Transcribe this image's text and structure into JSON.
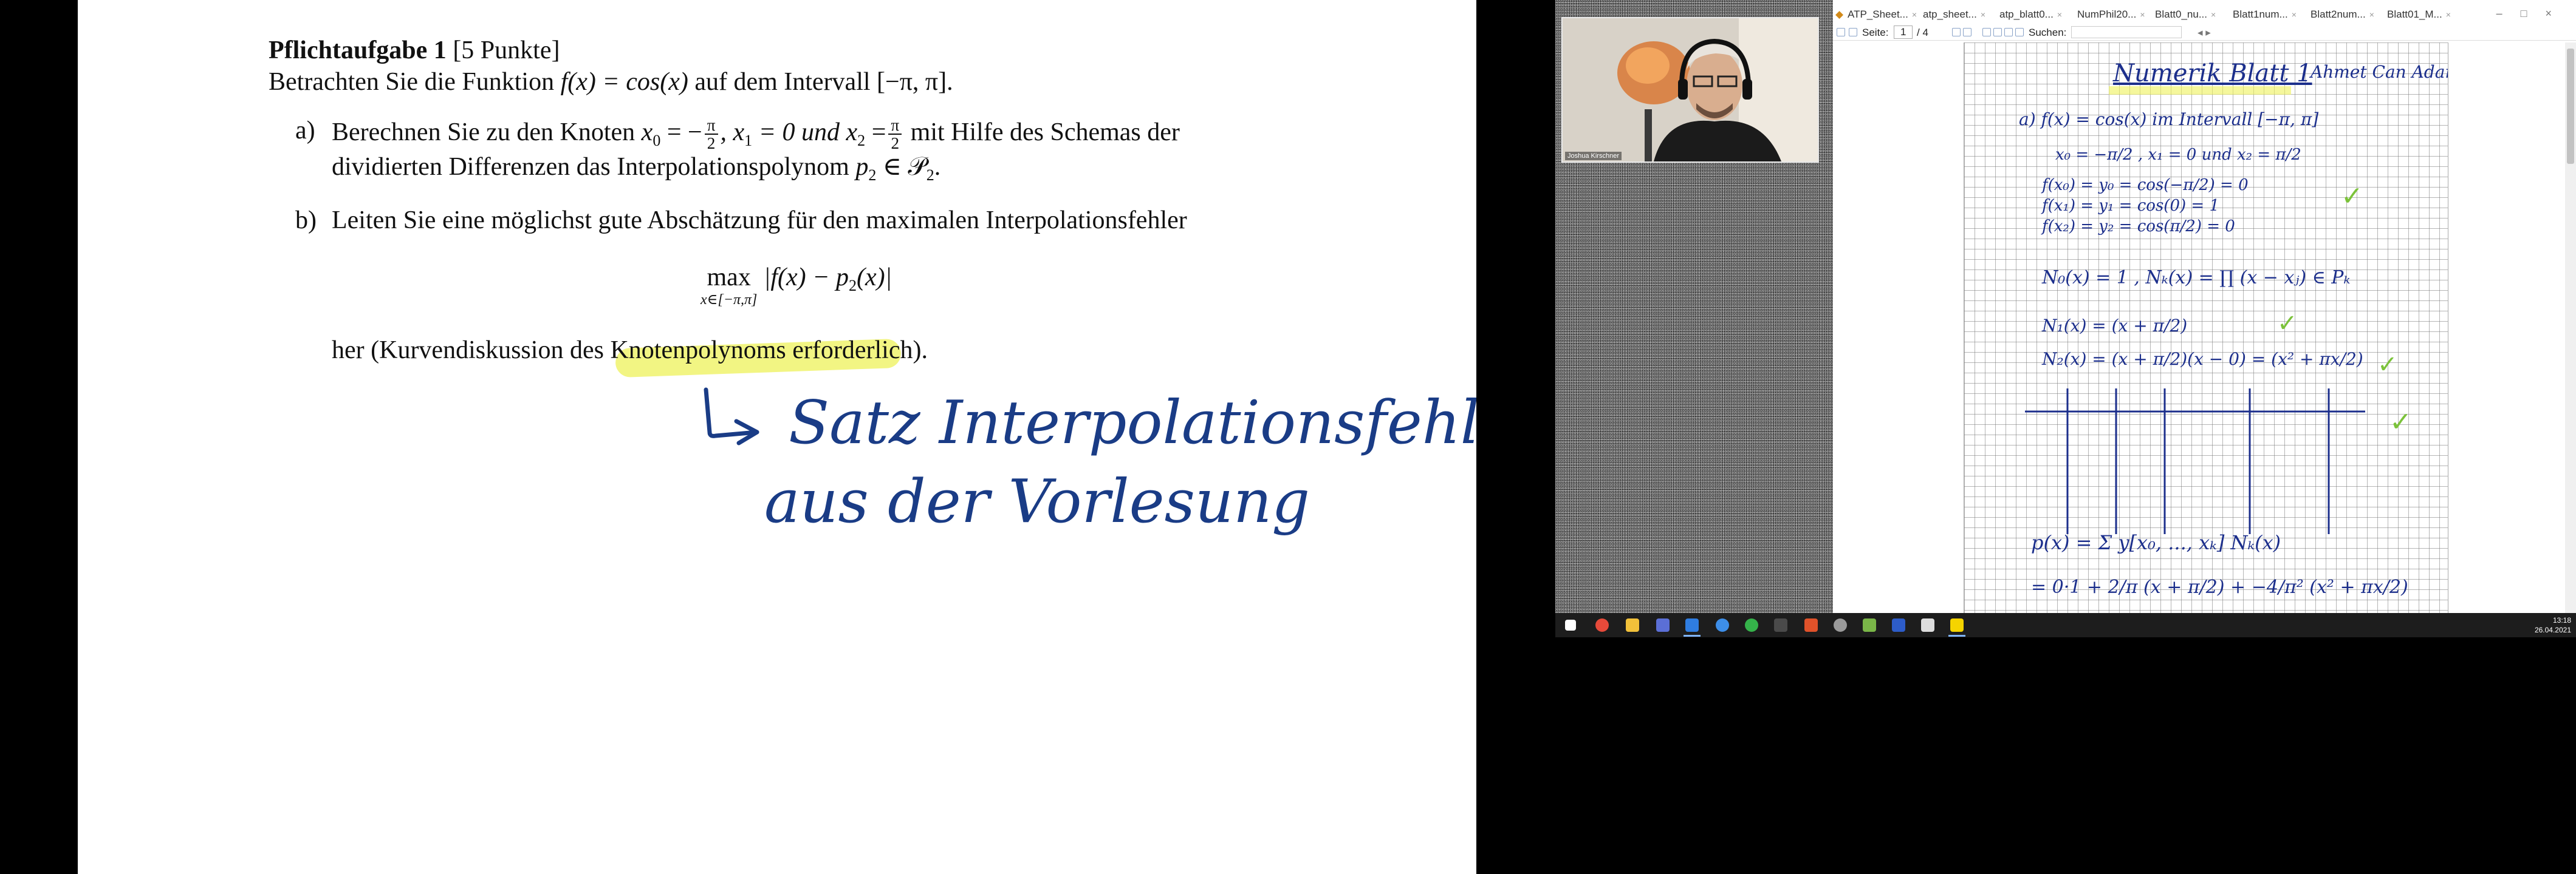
{
  "document": {
    "heading_bold": "Pflichtaufgabe 1",
    "heading_points": "[5 Punkte]",
    "intro": {
      "prefix": "Betrachten Sie die Funktion",
      "function": "f(x) = cos(x)",
      "middle": "auf dem Intervall",
      "interval": "[−π, π]."
    },
    "part_a": {
      "label": "a)",
      "line1_prefix": "Berechnen Sie zu den Knoten",
      "x0_lhs": "x",
      "x0_sub": "0",
      "x0_eq": "= −",
      "pi": "π",
      "two": "2",
      "x1": ", x",
      "x1_sub": "1",
      "x1_eq": "= 0 und x",
      "x2_sub": "2",
      "x2_eq": "=",
      "line1_suffix": "mit Hilfe des Schemas der",
      "line2": "dividierten Differenzen das Interpolationspolynom",
      "p2": "p",
      "p2_sub": "2",
      "p2_tail": "∈ 𝒫",
      "p2_tail_sub": "2",
      "period": "."
    },
    "part_b": {
      "label": "b)",
      "line1": "Leiten Sie eine möglichst gute Abschätzung für den maximalen Interpolationsfehler",
      "formula_max": "max",
      "formula_range": "x∈[−π,π]",
      "formula_body": "|f(x) − p",
      "formula_sub": "2",
      "formula_end": "(x)|",
      "line2_a": "her (Kurvendiskussion des",
      "line2_highlight": "Knotenpolynoms",
      "line2_b": "erforderlich)."
    },
    "handwriting": {
      "line1": "Satz Interpolationsfehler",
      "line2": "aus der Vorlesung"
    }
  },
  "remote": {
    "webcam_name": "Joshua Kirschner",
    "tabs": [
      "ATP_Sheet...",
      "atp_sheet...",
      "atp_blatt0...",
      "NumPhil20...",
      "Blatt0_nu...",
      "Blatt1num...",
      "Blatt2num...",
      "Blatt01_M..."
    ],
    "toolbar": {
      "page_label": "Seite:",
      "page_current": "1",
      "page_total": "/ 4",
      "search_label": "Suchen:"
    },
    "notes": {
      "title": "Numerik Blatt 1",
      "authors": "Ahmet Can Adamoglu",
      "a_line": "a)  f(x) = cos(x)   im Intervall [−π, π]",
      "nodes": "x₀ = −π/2 , x₁ = 0  und  x₂ = π/2",
      "f0": "f(x₀) = y₀ = cos(−π/2) = 0",
      "f1": "f(x₁) = y₁ = cos(0) = 1",
      "f2": "f(x₂) = y₂ = cos(π/2) = 0",
      "newton": "N₀(x) = 1 ,  Nₖ(x) = ∏ (x − xⱼ) ∈ Pₖ",
      "n1": "N₁(x) = (x + π/2)",
      "n2": "N₂(x) = (x + π/2)(x − 0) = (x² + πx/2)",
      "p_sum": "p(x) = Σ y[x₀, ..., xₖ] Nₖ(x)",
      "p_line": "= 0·1 + 2/π (x + π/2) + −4/π² (x² + πx/2)"
    },
    "clock_time": "13:18",
    "clock_date": "26.04.2021"
  }
}
